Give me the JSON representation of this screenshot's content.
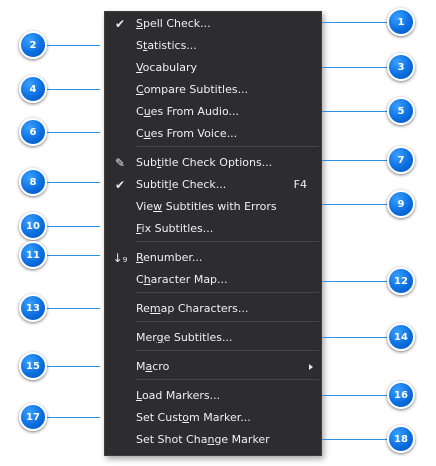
{
  "menu": {
    "items": [
      {
        "label": "Spell Check...",
        "ul": 0,
        "icon": "spell-check-icon",
        "glyph": "✔"
      },
      {
        "label": "Statistics...",
        "ul": 1
      },
      {
        "label": "Vocabulary",
        "ul": 0
      },
      {
        "label": "Compare Subtitles...",
        "ul": 0
      },
      {
        "label": "Cues From Audio...",
        "ul": 1
      },
      {
        "label": "Cues From Voice...",
        "ul": 1
      },
      {
        "label": "Subtitle Check Options...",
        "ul": 3,
        "icon": "check-options-icon",
        "glyph": "✎"
      },
      {
        "label": "Subtitle Check...",
        "ul": 6,
        "icon": "checkmark-icon",
        "glyph": "✔",
        "shortcut": "F4"
      },
      {
        "label": "View Subtitles with Errors",
        "ul": 3
      },
      {
        "label": "Fix Subtitles...",
        "ul": 0
      },
      {
        "label": "Renumber...",
        "ul": 0,
        "icon": "renumber-icon",
        "glyph": "↓₉"
      },
      {
        "label": "Character Map...",
        "ul": 1
      },
      {
        "label": "Remap Characters...",
        "ul": 2
      },
      {
        "label": "Merge Subtitles...",
        "ul": 3
      },
      {
        "label": "Macro",
        "ul": 1,
        "submenu": true
      },
      {
        "label": "Load Markers...",
        "ul": 0
      },
      {
        "label": "Set Custom Marker...",
        "ul": 8
      },
      {
        "label": "Set Shot Change Marker",
        "ul": 12
      }
    ]
  },
  "callouts": [
    "1",
    "2",
    "3",
    "4",
    "5",
    "6",
    "7",
    "8",
    "9",
    "10",
    "11",
    "12",
    "13",
    "14",
    "15",
    "16",
    "17",
    "18"
  ],
  "colors": {
    "menu_bg": "#2d2d30",
    "text": "#f1f1f1",
    "accent": "#1a7ee8"
  }
}
